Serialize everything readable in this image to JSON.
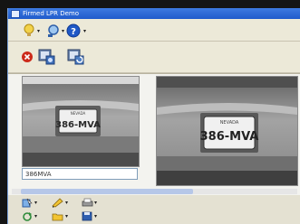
{
  "window": {
    "title": "Firmed LPR Demo"
  },
  "toolbar": {
    "row1": [
      {
        "icon": "lightbulb-icon"
      },
      {
        "icon": "magnifier-icon"
      },
      {
        "icon": "help-icon"
      }
    ],
    "row2": [
      {
        "icon": "stop-icon"
      },
      {
        "icon": "camera-settings-icon"
      },
      {
        "icon": "camera-refresh-icon"
      }
    ]
  },
  "viewers": {
    "left": {
      "plate_text": "386-MVA",
      "plate_state": "NEVADA"
    },
    "right": {
      "plate_text": "386-MVA",
      "plate_state": "NEVADA"
    }
  },
  "result": {
    "value": "386MVA"
  },
  "bottom_toolbar": [
    {
      "icon": "pointer-icon"
    },
    {
      "icon": "pencil-icon"
    },
    {
      "icon": "printer-icon"
    },
    {
      "icon": "refresh-icon"
    },
    {
      "icon": "folder-icon"
    },
    {
      "icon": "save-icon"
    }
  ],
  "colors": {
    "titlebar": "#2a63d4",
    "accent_red": "#cc2a1a"
  }
}
